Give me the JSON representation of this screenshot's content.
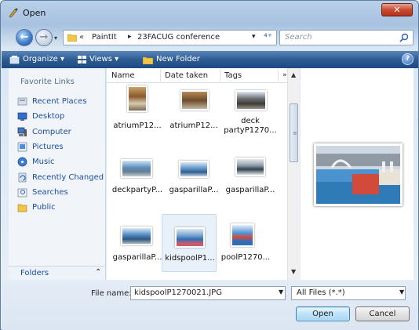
{
  "window": {
    "title": "Open",
    "close_glyph": "✕"
  },
  "navigation": {
    "back_glyph": "←",
    "forward_glyph": "→",
    "recent_dropdown_glyph": "▾"
  },
  "address": {
    "chevron": "«",
    "crumbs": [
      "PaintIt",
      "23FACUG conference"
    ],
    "separator": "▸",
    "dropdown_glyph": "▾",
    "refresh_glyph": "⁴⁺"
  },
  "search": {
    "placeholder": "Search"
  },
  "toolbar": {
    "organize": "Organize ▾",
    "views": "Views ▾",
    "new_folder": "New Folder",
    "help": "?"
  },
  "nav_pane": {
    "title": "Favorite Links",
    "items": [
      {
        "label": "Recent Places",
        "icon": "recent-places-icon"
      },
      {
        "label": "Desktop",
        "icon": "desktop-icon"
      },
      {
        "label": "Computer",
        "icon": "computer-icon"
      },
      {
        "label": "Pictures",
        "icon": "pictures-icon"
      },
      {
        "label": "Music",
        "icon": "music-icon"
      },
      {
        "label": "Recently Changed",
        "icon": "recently-changed-icon"
      },
      {
        "label": "Searches",
        "icon": "searches-icon"
      },
      {
        "label": "Public",
        "icon": "public-folder-icon"
      }
    ],
    "folders_label": "Folders",
    "folders_toggle": "⌃"
  },
  "file_list": {
    "columns": [
      "Name",
      "Date taken",
      "Tags"
    ],
    "more_columns": "»",
    "files": [
      {
        "name": "atriumP12...",
        "selected": false
      },
      {
        "name": "atriumP12...",
        "selected": false
      },
      {
        "name": "deck partyP1270...",
        "selected": false
      },
      {
        "name": "deckpartyP...",
        "selected": false
      },
      {
        "name": "gasparillaP...",
        "selected": false
      },
      {
        "name": "gasparillaP...",
        "selected": false
      },
      {
        "name": "gasparillaP...",
        "selected": false
      },
      {
        "name": "kidspoolP1...",
        "selected": true
      },
      {
        "name": "poolP1270...",
        "selected": false
      }
    ],
    "scroll_up": "▲",
    "scroll_down": "▼",
    "grip": "≡"
  },
  "bottom": {
    "filename_label": "File name:",
    "filename_value": "kidspoolP1270021.JPG",
    "filename_drop": "▼",
    "filetype_value": "All Files (*.*)",
    "filetype_drop": "▼",
    "open_label": "Open",
    "cancel_label": "Cancel"
  },
  "colors": {
    "toolbar": "#2d5c93",
    "link": "#1c4ea0",
    "selection": "#e8f0f9"
  }
}
